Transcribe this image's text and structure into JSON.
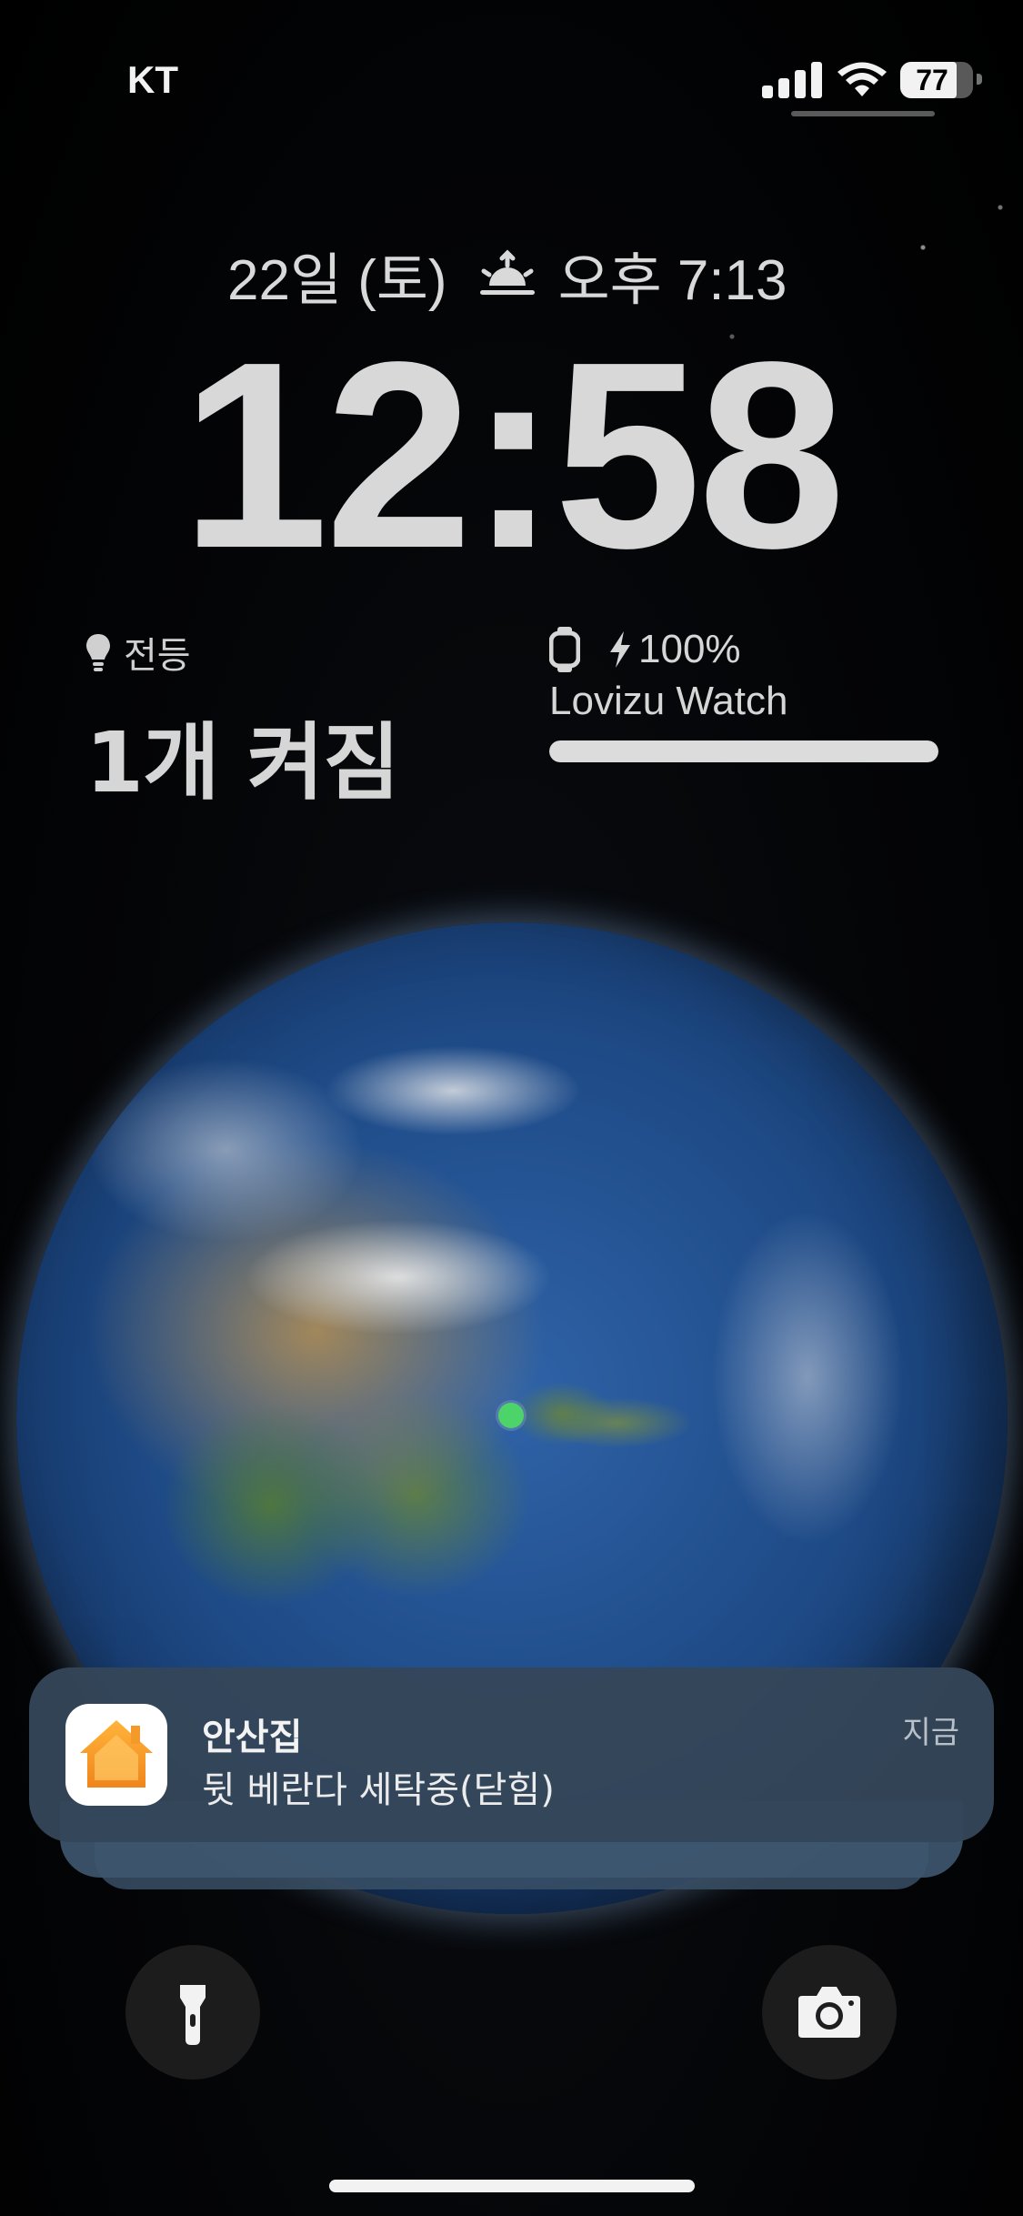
{
  "status_bar": {
    "carrier": "KT",
    "battery_level": 77,
    "battery_text": "77",
    "signal_bars": 4,
    "icons": [
      "signal-icon",
      "wifi-icon",
      "battery-icon"
    ]
  },
  "lock_screen": {
    "date": "22일 (토)",
    "sunset_time": "오후 7:13",
    "time": "12:58"
  },
  "widgets": {
    "light": {
      "icon": "lightbulb-icon",
      "label": "전등",
      "value": "1개 켜짐"
    },
    "watch": {
      "icon": "watch-icon",
      "charge_icon": "bolt-icon",
      "battery": "100%",
      "battery_fraction": 1.0,
      "device_name": "Lovizu Watch"
    }
  },
  "notification": {
    "app_icon": "home-app-icon",
    "title": "안산집",
    "body": "뒷 베란다 세탁중(닫힘)",
    "time": "지금"
  },
  "controls": {
    "flashlight_icon": "flashlight-icon",
    "camera_icon": "camera-icon"
  },
  "colors": {
    "location_dot": "#4cd36a",
    "home_icon_orange": "#f5a623"
  }
}
